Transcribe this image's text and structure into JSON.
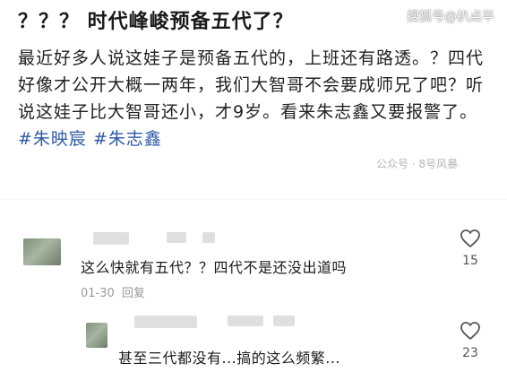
{
  "post": {
    "title": "？？？ 时代峰峻预备五代了？",
    "body": "最近好多人说这娃子是预备五代的，上班还有路透。？四代好像才公开大概一两年，我们大智哥不会要成师兄了吧？听说这娃子比大智哥还小，才9岁。看来朱志鑫又要报警了。",
    "tags": [
      "#朱映宸",
      "#朱志鑫"
    ],
    "source": "公众号 · 8号风暴"
  },
  "watermark": "搜狐号@扒点半",
  "comments": [
    {
      "text": "这么快就有五代？？四代不是还没出道吗",
      "date": "01-30",
      "reply_label": "回复",
      "likes": "15",
      "like_icon": "heart-outline-icon"
    },
    {
      "text": "甚至三代都没有...搞的这么频繁...",
      "likes": "23",
      "like_icon": "heart-outline-icon"
    }
  ]
}
